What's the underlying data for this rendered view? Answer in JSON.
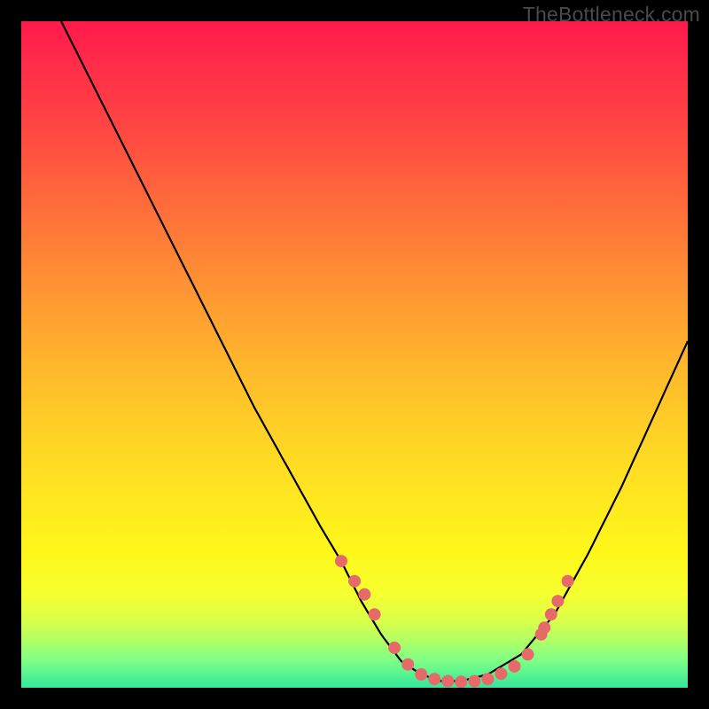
{
  "watermark": "TheBottleneck.com",
  "colors": {
    "curve": "#000000",
    "dots": "#e76a6a",
    "gradient_top": "#ff1a4b",
    "gradient_bottom": "#33e79a"
  },
  "chart_data": {
    "type": "line",
    "title": "",
    "xlabel": "",
    "ylabel": "",
    "xlim": [
      0,
      100
    ],
    "ylim": [
      0,
      100
    ],
    "note": "Axes are unlabeled in the image. Values below are percentage coordinates (0 = left/bottom, 100 = right/top) estimated from pixel positions.",
    "series": [
      {
        "name": "bottleneck-curve",
        "x": [
          6,
          10,
          15,
          20,
          25,
          30,
          35,
          40,
          45,
          48,
          51,
          54,
          57,
          60,
          63,
          66,
          70,
          75,
          80,
          85,
          90,
          95,
          100
        ],
        "y": [
          100,
          92,
          82,
          72,
          62,
          52,
          42,
          33,
          24,
          19,
          13,
          8,
          4,
          2,
          1,
          1,
          2,
          5,
          11,
          20,
          30,
          41,
          52
        ]
      }
    ],
    "highlight_points": {
      "name": "dots",
      "x": [
        48,
        50,
        51.5,
        53,
        56,
        58,
        60,
        62,
        64,
        66,
        68,
        70,
        72,
        74,
        76,
        78,
        78.5,
        79.5,
        80.5,
        82
      ],
      "y": [
        19,
        16,
        14,
        11,
        6,
        3.5,
        2,
        1.3,
        1,
        0.9,
        1,
        1.3,
        2.1,
        3.2,
        5,
        8,
        9,
        11,
        13,
        16
      ]
    }
  }
}
